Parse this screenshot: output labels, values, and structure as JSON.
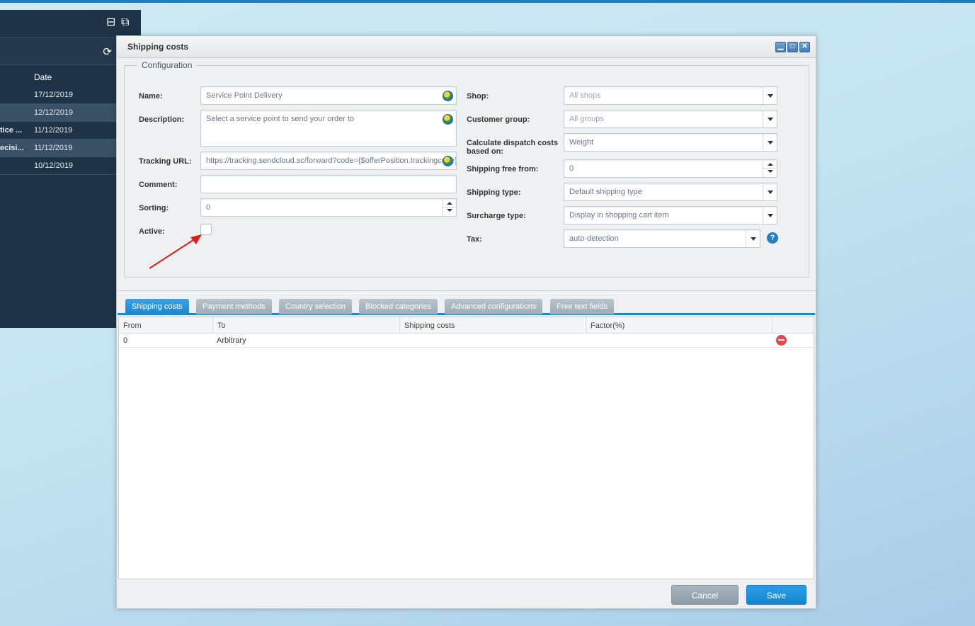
{
  "background_list": {
    "column_date": "Date",
    "rows": [
      {
        "name": "",
        "date": "17/12/2019"
      },
      {
        "name": "",
        "date": "12/12/2019"
      },
      {
        "name": "tice ...",
        "date": "11/12/2019"
      },
      {
        "name": "ecisi...",
        "date": "11/12/2019"
      },
      {
        "name": "",
        "date": "10/12/2019"
      }
    ]
  },
  "window": {
    "title": "Shipping costs",
    "controls": {
      "minimize": "▁",
      "maximize": "□",
      "close": "✕"
    }
  },
  "config": {
    "legend": "Configuration",
    "name": {
      "label": "Name:",
      "value": "Service Point Delivery"
    },
    "description": {
      "label": "Description:",
      "value": "Select a service point to send your order to"
    },
    "tracking_url": {
      "label": "Tracking URL:",
      "value": "https://tracking.sendcloud.sc/forward?code={$offerPosition.trackingcode}"
    },
    "comment": {
      "label": "Comment:",
      "value": ""
    },
    "sorting": {
      "label": "Sorting:",
      "value": "0"
    },
    "active": {
      "label": "Active:",
      "checked": false
    },
    "shop": {
      "label": "Shop:",
      "value": "All shops"
    },
    "customer_group": {
      "label": "Customer group:",
      "value": "All groups"
    },
    "calc_dispatch": {
      "label": "Calculate dispatch costs based on:",
      "value": "Weight"
    },
    "shipping_free_from": {
      "label": "Shipping free from:",
      "value": "0"
    },
    "shipping_type": {
      "label": "Shipping type:",
      "value": "Default shipping type"
    },
    "surcharge_type": {
      "label": "Surcharge type:",
      "value": "Display in shopping cart item"
    },
    "tax": {
      "label": "Tax:",
      "value": "auto-detection"
    }
  },
  "tabs": [
    {
      "label": "Shipping costs",
      "active": true
    },
    {
      "label": "Payment methods"
    },
    {
      "label": "Country selection"
    },
    {
      "label": "Blocked categories"
    },
    {
      "label": "Advanced configurations"
    },
    {
      "label": "Free text fields"
    }
  ],
  "grid": {
    "columns": [
      "From",
      "To",
      "Shipping costs",
      "Factor(%)"
    ],
    "rows": [
      {
        "from": "0",
        "to": "Arbitrary",
        "shipping_costs": "",
        "factor": ""
      }
    ]
  },
  "footer": {
    "cancel": "Cancel",
    "save": "Save"
  },
  "colors": {
    "accent": "#1f86cc",
    "annotation_arrow": "#e01b1b"
  }
}
